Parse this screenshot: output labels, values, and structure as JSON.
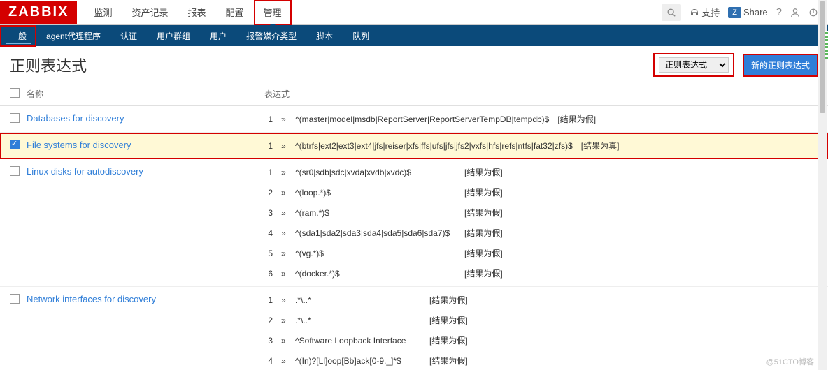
{
  "logo": "ZABBIX",
  "topnav": [
    "监测",
    "资产记录",
    "报表",
    "配置",
    "管理"
  ],
  "topnav_active": 4,
  "topright": {
    "support": "支持",
    "share": "Share"
  },
  "subnav": [
    "一般",
    "agent代理程序",
    "认证",
    "用户群组",
    "用户",
    "报警媒介类型",
    "脚本",
    "队列"
  ],
  "subnav_active": 0,
  "page_title": "正则表达式",
  "select_value": "正则表达式",
  "new_button": "新的正则表达式",
  "columns": {
    "name": "名称",
    "expr": "表达式"
  },
  "rows": [
    {
      "name": "Databases for discovery",
      "checked": false,
      "expressions": [
        {
          "n": "1",
          "pattern": "^(master|model|msdb|ReportServer|ReportServerTempDB|tempdb)$",
          "result": "[结果为假]"
        }
      ]
    },
    {
      "name": "File systems for discovery",
      "checked": true,
      "expressions": [
        {
          "n": "1",
          "pattern": "^(btrfs|ext2|ext3|ext4|jfs|reiser|xfs|ffs|ufs|jfs|jfs2|vxfs|hfs|refs|ntfs|fat32|zfs)$",
          "result": "[结果为真]"
        }
      ]
    },
    {
      "name": "Linux disks for autodiscovery",
      "checked": false,
      "expressions": [
        {
          "n": "1",
          "pattern": "^(sr0|sdb|sdc|xvda|xvdb|xvdc)$",
          "result": "[结果为假]"
        },
        {
          "n": "2",
          "pattern": "^(loop.*)$",
          "result": "[结果为假]"
        },
        {
          "n": "3",
          "pattern": "^(ram.*)$",
          "result": "[结果为假]"
        },
        {
          "n": "4",
          "pattern": "^(sda1|sda2|sda3|sda4|sda5|sda6|sda7)$",
          "result": "[结果为假]"
        },
        {
          "n": "5",
          "pattern": "^(vg.*)$",
          "result": "[结果为假]"
        },
        {
          "n": "6",
          "pattern": "^(docker.*)$",
          "result": "[结果为假]"
        }
      ]
    },
    {
      "name": "Network interfaces for discovery",
      "checked": false,
      "expressions": [
        {
          "n": "1",
          "pattern": ".*\\..*",
          "result": "[结果为假]"
        },
        {
          "n": "2",
          "pattern": ".*\\..*",
          "result": "[结果为假]"
        },
        {
          "n": "3",
          "pattern": "^Software Loopback Interface",
          "result": "[结果为假]"
        },
        {
          "n": "4",
          "pattern": "^(In)?[Ll]oop[Bb]ack[0-9._]*$",
          "result": "[结果为假]"
        }
      ]
    }
  ],
  "watermark": "@51CTO博客"
}
